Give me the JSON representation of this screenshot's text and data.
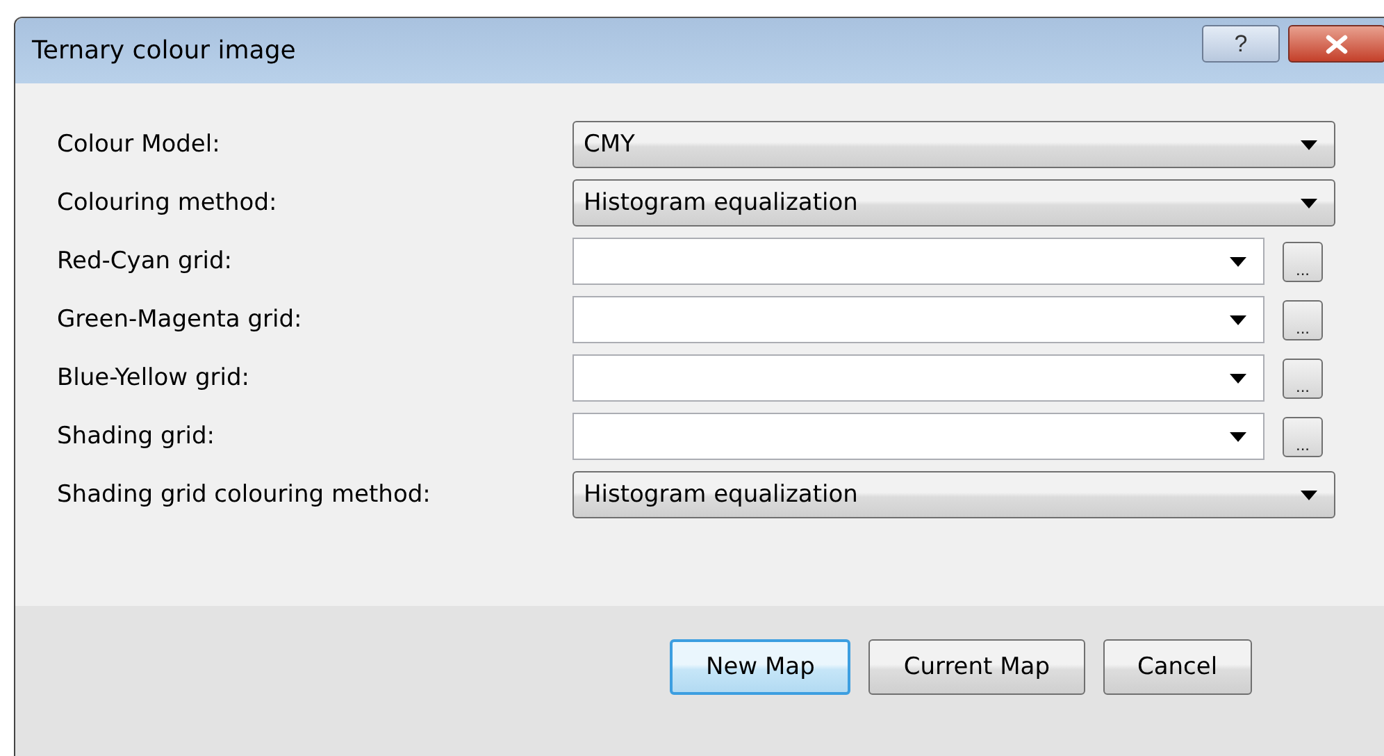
{
  "window": {
    "title": "Ternary colour image",
    "help_button": "?"
  },
  "fields": [
    {
      "label": "Colour Model:",
      "kind": "combo",
      "value": "CMY"
    },
    {
      "label": "Colouring method:",
      "kind": "combo",
      "value": "Histogram equalization"
    },
    {
      "label": "Red-Cyan grid:",
      "kind": "grid",
      "browse": "..."
    },
    {
      "label": "Green-Magenta grid:",
      "kind": "grid",
      "browse": "..."
    },
    {
      "label": "Blue-Yellow grid:",
      "kind": "grid",
      "browse": "..."
    },
    {
      "label": "Shading grid:",
      "kind": "grid",
      "browse": "..."
    },
    {
      "label": "Shading grid colouring method:",
      "kind": "combo",
      "value": "Histogram equalization"
    }
  ],
  "buttons": [
    {
      "label": "New Map",
      "default": true
    },
    {
      "label": "Current Map",
      "default": false
    },
    {
      "label": "Cancel",
      "default": false
    }
  ]
}
